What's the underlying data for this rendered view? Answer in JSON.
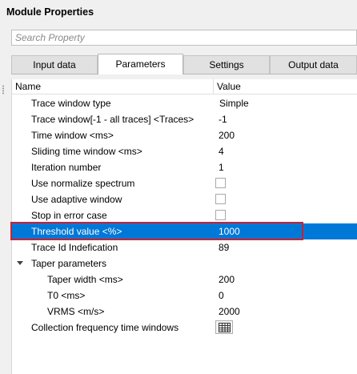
{
  "panel": {
    "title": "Module Properties"
  },
  "search": {
    "placeholder": "Search Property"
  },
  "tabs": [
    {
      "label": "Input data",
      "active": false
    },
    {
      "label": "Parameters",
      "active": true
    },
    {
      "label": "Settings",
      "active": false
    },
    {
      "label": "Output data",
      "active": false
    }
  ],
  "grid": {
    "columns": {
      "name": "Name",
      "value": "Value"
    },
    "rows": [
      {
        "name": "Trace window type",
        "value": "Simple"
      },
      {
        "name": "Trace window[-1 - all traces] <Traces>",
        "value": "-1"
      },
      {
        "name": "Time window <ms>",
        "value": "200"
      },
      {
        "name": "Sliding time window <ms>",
        "value": "4"
      },
      {
        "name": "Iteration number",
        "value": "1"
      },
      {
        "name": "Use normalize spectrum",
        "type": "checkbox",
        "checked": false
      },
      {
        "name": "Use adaptive window",
        "type": "checkbox",
        "checked": false
      },
      {
        "name": "Stop in error case",
        "type": "checkbox",
        "checked": false
      },
      {
        "name": "Threshold value <%>",
        "value": "1000",
        "selected": true
      },
      {
        "name": "Trace Id Indefication",
        "value": "89"
      },
      {
        "name": "Taper parameters",
        "type": "group",
        "expanded": true
      },
      {
        "name": "Taper width <ms>",
        "value": "200"
      },
      {
        "name": "T0 <ms>",
        "value": "0"
      },
      {
        "name": "VRMS <m/s>",
        "value": "2000"
      },
      {
        "name": "Collection frequency time windows",
        "type": "table-button",
        "icon": "table-icon"
      }
    ]
  },
  "colors": {
    "selection": "#0078d7",
    "highlight_border": "#d0202f"
  }
}
